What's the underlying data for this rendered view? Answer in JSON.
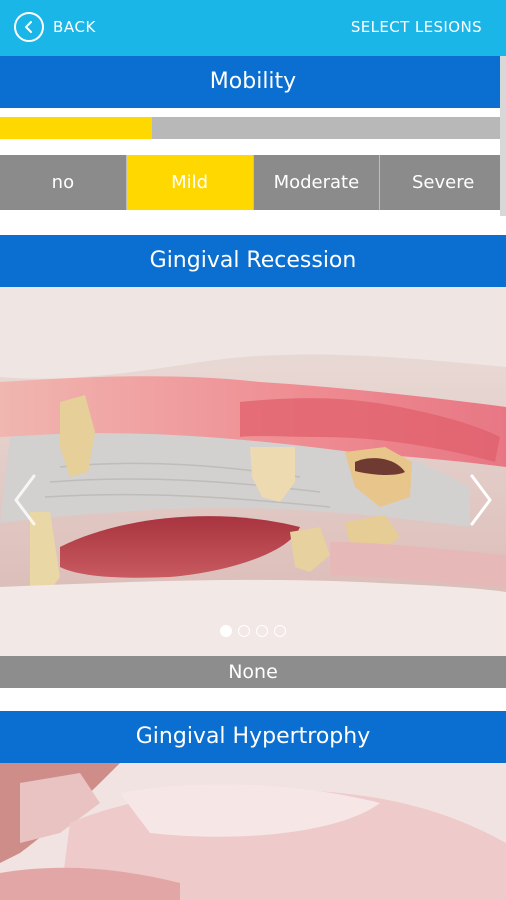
{
  "topbar": {
    "back_label": "BACK",
    "select_label": "SELECT LESIONS"
  },
  "mobility": {
    "title": "Mobility",
    "progress_fraction": 0.3,
    "options": [
      "no",
      "Mild",
      "Moderate",
      "Severe"
    ],
    "selected": "Mild"
  },
  "recession": {
    "title": "Gingival Recession",
    "caption": "None",
    "slide_count": 4,
    "active_slide": 1
  },
  "hypertrophy": {
    "title": "Gingival Hypertrophy"
  },
  "colors": {
    "topbar": "#1ab6e8",
    "header": "#0a6fd0",
    "selected": "#ffd800",
    "unselected": "#8b8b8b"
  },
  "icons": [
    "chevron-left-circle-icon",
    "chevron-left-icon",
    "chevron-right-icon"
  ]
}
